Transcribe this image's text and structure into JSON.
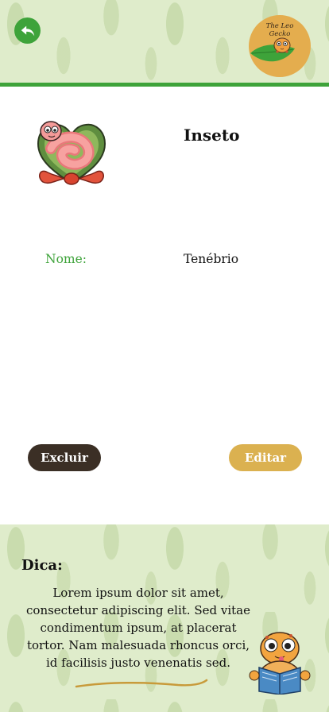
{
  "header": {
    "back_icon": "arrow-back-icon",
    "logo_text_line1": "The Leo",
    "logo_text_line2": "Gecko"
  },
  "product": {
    "image_icon": "worm-in-heart-illustration",
    "category": "Inseto",
    "fields": [
      {
        "label": "Nome:",
        "value": "Tenébrio"
      }
    ]
  },
  "actions": {
    "delete_label": "Excluir",
    "edit_label": "Editar"
  },
  "tip": {
    "title": "Dica:",
    "text": "Lorem ipsum dolor sit amet, consectetur adipiscing elit. Sed vitae condimentum ipsum, at placerat tortor. Nam malesuada rhoncus orci, id facilisis justo venenatis sed.",
    "illustration_icon": "gecko-reading-book-illustration"
  },
  "colors": {
    "accent_green": "#3ea33a",
    "delete_button": "#3b2f25",
    "edit_button": "#dbb150",
    "leaf_background": "#dfeccb"
  }
}
